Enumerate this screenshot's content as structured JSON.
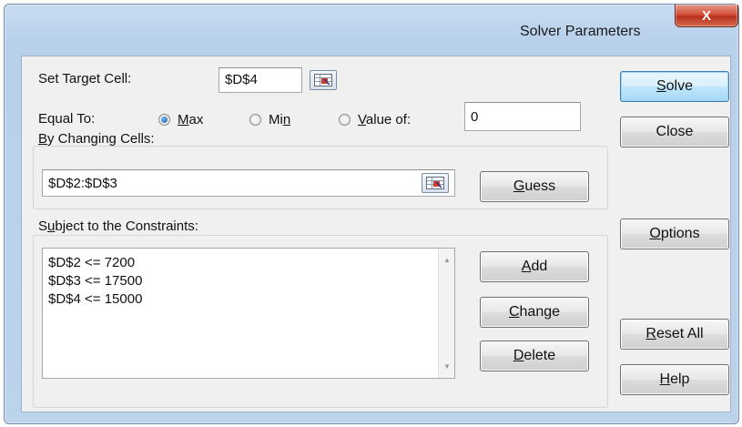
{
  "window": {
    "title": "Solver Parameters",
    "close_glyph": "X"
  },
  "target": {
    "label_pre": "Set Target Cell:",
    "value": "$D$4"
  },
  "equal_to": {
    "label": "Equal To:",
    "options": [
      {
        "pre": "",
        "u": "M",
        "post": "ax",
        "selected": true
      },
      {
        "pre": "Mi",
        "u": "n",
        "post": "",
        "selected": false
      },
      {
        "pre": "",
        "u": "V",
        "post": "alue of:",
        "selected": false
      }
    ],
    "value_of": "0"
  },
  "changing": {
    "label_pre": "",
    "label_u": "B",
    "label_post": "y Changing Cells:",
    "value": "$D$2:$D$3",
    "guess": {
      "pre": "",
      "u": "G",
      "post": "uess"
    }
  },
  "constraints": {
    "label_pre": "S",
    "label_u": "u",
    "label_post": "bject to the Constraints:",
    "items": [
      "$D$2 <= 7200",
      "$D$3 <= 17500",
      "$D$4 <= 15000"
    ]
  },
  "buttons": {
    "solve": {
      "pre": "",
      "u": "S",
      "post": "olve"
    },
    "close": {
      "pre": "Close",
      "u": "",
      "post": ""
    },
    "options": {
      "pre": "",
      "u": "O",
      "post": "ptions"
    },
    "add": {
      "pre": "",
      "u": "A",
      "post": "dd"
    },
    "change": {
      "pre": "",
      "u": "C",
      "post": "hange"
    },
    "delete": {
      "pre": "",
      "u": "D",
      "post": "elete"
    },
    "reset": {
      "pre": "",
      "u": "R",
      "post": "eset All"
    },
    "help": {
      "pre": "",
      "u": "H",
      "post": "elp"
    }
  },
  "colors": {
    "accent": "#3c7fb1",
    "close_red": "#c8402a",
    "frame": "#b8d0ea"
  }
}
